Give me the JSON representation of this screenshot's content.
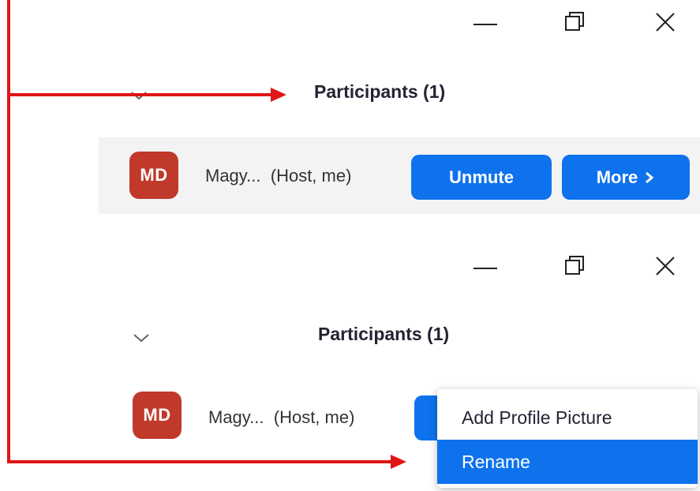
{
  "top_panel": {
    "window_controls": {
      "minimize": "minimize-icon",
      "restore": "restore-icon",
      "close": "close-icon"
    },
    "title": "Participants (1)",
    "participant": {
      "initials": "MD",
      "name": "Magy...",
      "role": "(Host, me)",
      "unmute_label": "Unmute",
      "more_label": "More"
    }
  },
  "bottom_panel": {
    "window_controls": {
      "minimize": "minimize-icon",
      "restore": "restore-icon",
      "close": "close-icon"
    },
    "title": "Participants (1)",
    "participant": {
      "initials": "MD",
      "name": "Magy...",
      "role": "(Host, me)"
    },
    "context_menu": {
      "items": [
        {
          "label": "Add Profile Picture",
          "selected": false
        },
        {
          "label": "Rename",
          "selected": true
        }
      ]
    }
  },
  "colors": {
    "accent_blue": "#0e72ed",
    "avatar_red": "#c0392b",
    "annotation_red": "#e01515",
    "row_highlight": "#f3f3f4"
  }
}
